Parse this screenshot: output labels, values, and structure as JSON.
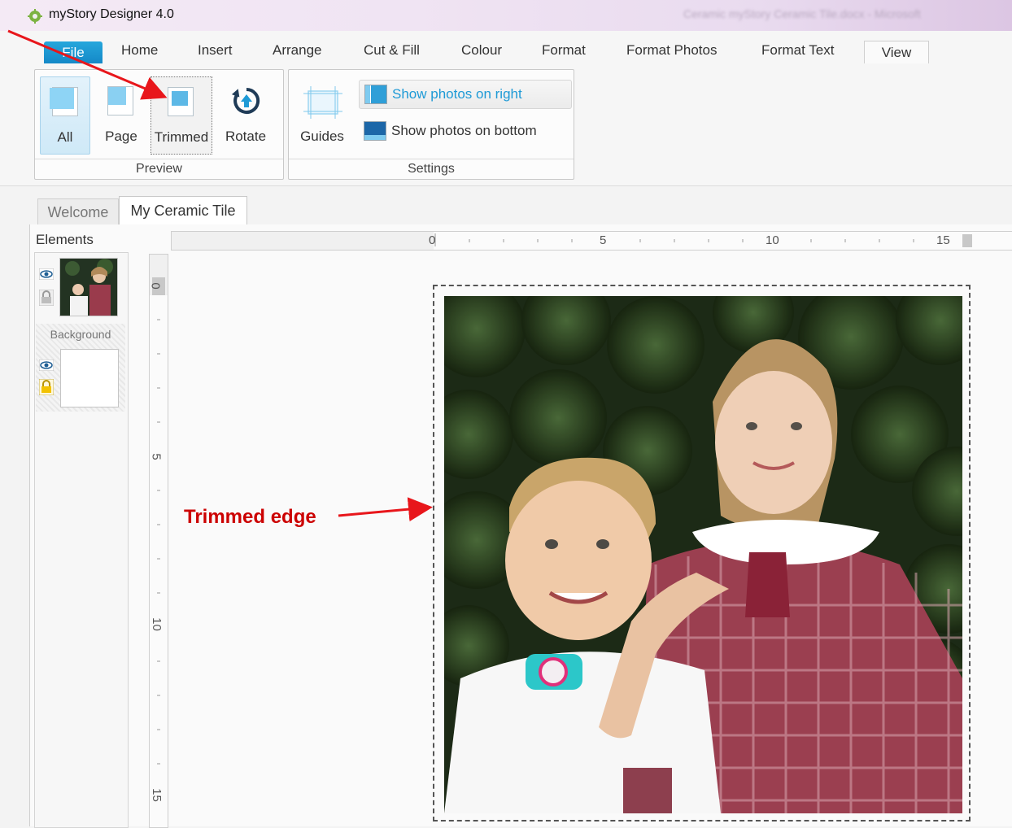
{
  "window": {
    "app_title": "myStory Designer 4.0",
    "document_title": "Ceramic myStory Ceramic Tile.docx - Microsoft"
  },
  "tabs": [
    "File",
    "Home",
    "Insert",
    "Arrange",
    "Cut & Fill",
    "Colour",
    "Format",
    "Format Photos",
    "Format Text",
    "View"
  ],
  "ribbon": {
    "preview": {
      "group_label": "Preview",
      "buttons": [
        "All",
        "Page",
        "Trimmed",
        "Rotate"
      ]
    },
    "settings": {
      "group_label": "Settings",
      "guides_label": "Guides",
      "show_right_label": "Show photos on right",
      "show_bottom_label": "Show photos on bottom"
    }
  },
  "document_tabs": [
    "Welcome",
    "My Ceramic Tile"
  ],
  "elements_panel": {
    "title": "Elements",
    "background_label": "Background"
  },
  "rulers": {
    "horizontal_labels": [
      "0",
      "5",
      "10",
      "15"
    ],
    "vertical_labels": [
      "0",
      "5",
      "10",
      "15"
    ]
  },
  "annotation": {
    "label": "Trimmed edge",
    "color": "#cc0000"
  },
  "colors": {
    "accent": "#1e9ad6",
    "file_tab": "#1b95d2"
  }
}
